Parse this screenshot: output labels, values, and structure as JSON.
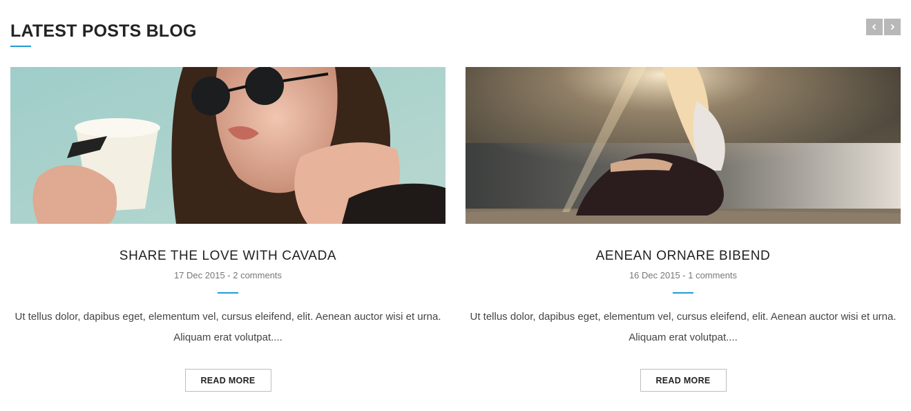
{
  "section": {
    "title": "LATEST POSTS BLOG",
    "nav": {
      "prev_icon": "chevron-left-icon",
      "next_icon": "chevron-right-icon"
    }
  },
  "colors": {
    "accent": "#1e9bd6",
    "nav_button": "#b8b8b8"
  },
  "posts": [
    {
      "image": "photo-woman-sunglasses-coffee",
      "title": "SHARE THE LOVE WITH CAVADA",
      "meta": "17 Dec 2015 - 2 comments",
      "excerpt": "Ut tellus dolor, dapibus eget, elementum vel, cursus eleifend, elit. Aenean auctor wisi et urna. Aliquam erat volutpat....",
      "read_more": "READ MORE"
    },
    {
      "image": "photo-woman-sitting-lakeside",
      "title": "AENEAN ORNARE BIBEND",
      "meta": "16 Dec 2015 - 1 comments",
      "excerpt": "Ut tellus dolor, dapibus eget, elementum vel, cursus eleifend, elit. Aenean auctor wisi et urna. Aliquam erat volutpat....",
      "read_more": "READ MORE"
    }
  ]
}
